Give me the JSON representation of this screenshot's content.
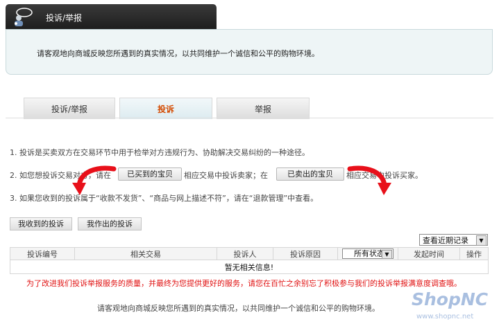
{
  "header": {
    "title": "投诉/举报"
  },
  "notice": {
    "text": "请客观地向商城反映您所遇到的真实情况，以共同维护一个诚信和公平的购物环境。"
  },
  "tabs": [
    {
      "label": "投诉/举报",
      "active": false
    },
    {
      "label": "投诉",
      "active": true
    },
    {
      "label": "举报",
      "active": false
    }
  ],
  "instructions": {
    "line1": "1. 投诉是买卖双方在交易环节中用于检举对方违规行为、协助解决交易纠纷的一种途径。",
    "line2_a": "2. 如您想投诉交易对方，请在",
    "bought_btn": "已买到的宝贝",
    "line2_b": "相应交易中投诉卖家；在",
    "sold_btn": "已卖出的宝贝",
    "line2_c": "相应交易中投诉买家。",
    "line3": "3. 如果您收到的投诉属于“收款不发货”、“商品与网上描述不符”，请在“退款管理”中查看。"
  },
  "subtabs": {
    "received": "我收到的投诉",
    "made": "我作出的投诉"
  },
  "filter": {
    "recent": "查看近期记录"
  },
  "table": {
    "headers": [
      "投诉编号",
      "相关交易",
      "投诉人",
      "投诉原因",
      "所有状态",
      "发起时间",
      "操作"
    ],
    "empty": "暂无相关信息!"
  },
  "survey": {
    "text": "为了改进我们投诉举报服务的质量，并最终为您提供更好的服务，请您在百忙之余别忘了积极参与我们的投诉举报满意度调查哦。"
  },
  "footer": {
    "text": "请客观地向商城反映您所遇到的真实情况，以共同维护一个诚信和公平的购物环境。"
  },
  "watermark": {
    "brand": "ShopNC",
    "url": "www.shopnc.net"
  },
  "colors": {
    "active_tab": "#d44a00",
    "arrow": "#e8101a",
    "survey": "#e01010"
  }
}
